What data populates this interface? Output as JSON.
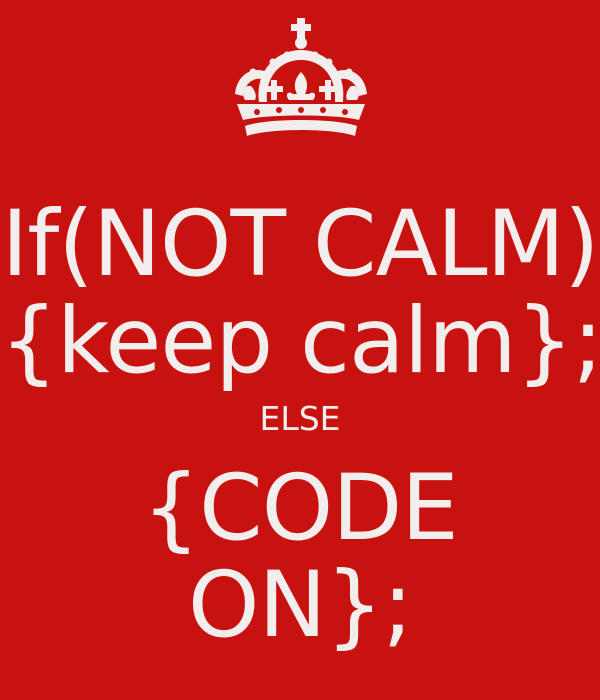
{
  "poster": {
    "background_color": "#c8120f",
    "text_color": "#f2eeee",
    "emblem": "crown-icon",
    "lines": [
      "If(NOT CALM)",
      "{keep calm};",
      "ELSE",
      "{CODE",
      "ON};"
    ]
  }
}
